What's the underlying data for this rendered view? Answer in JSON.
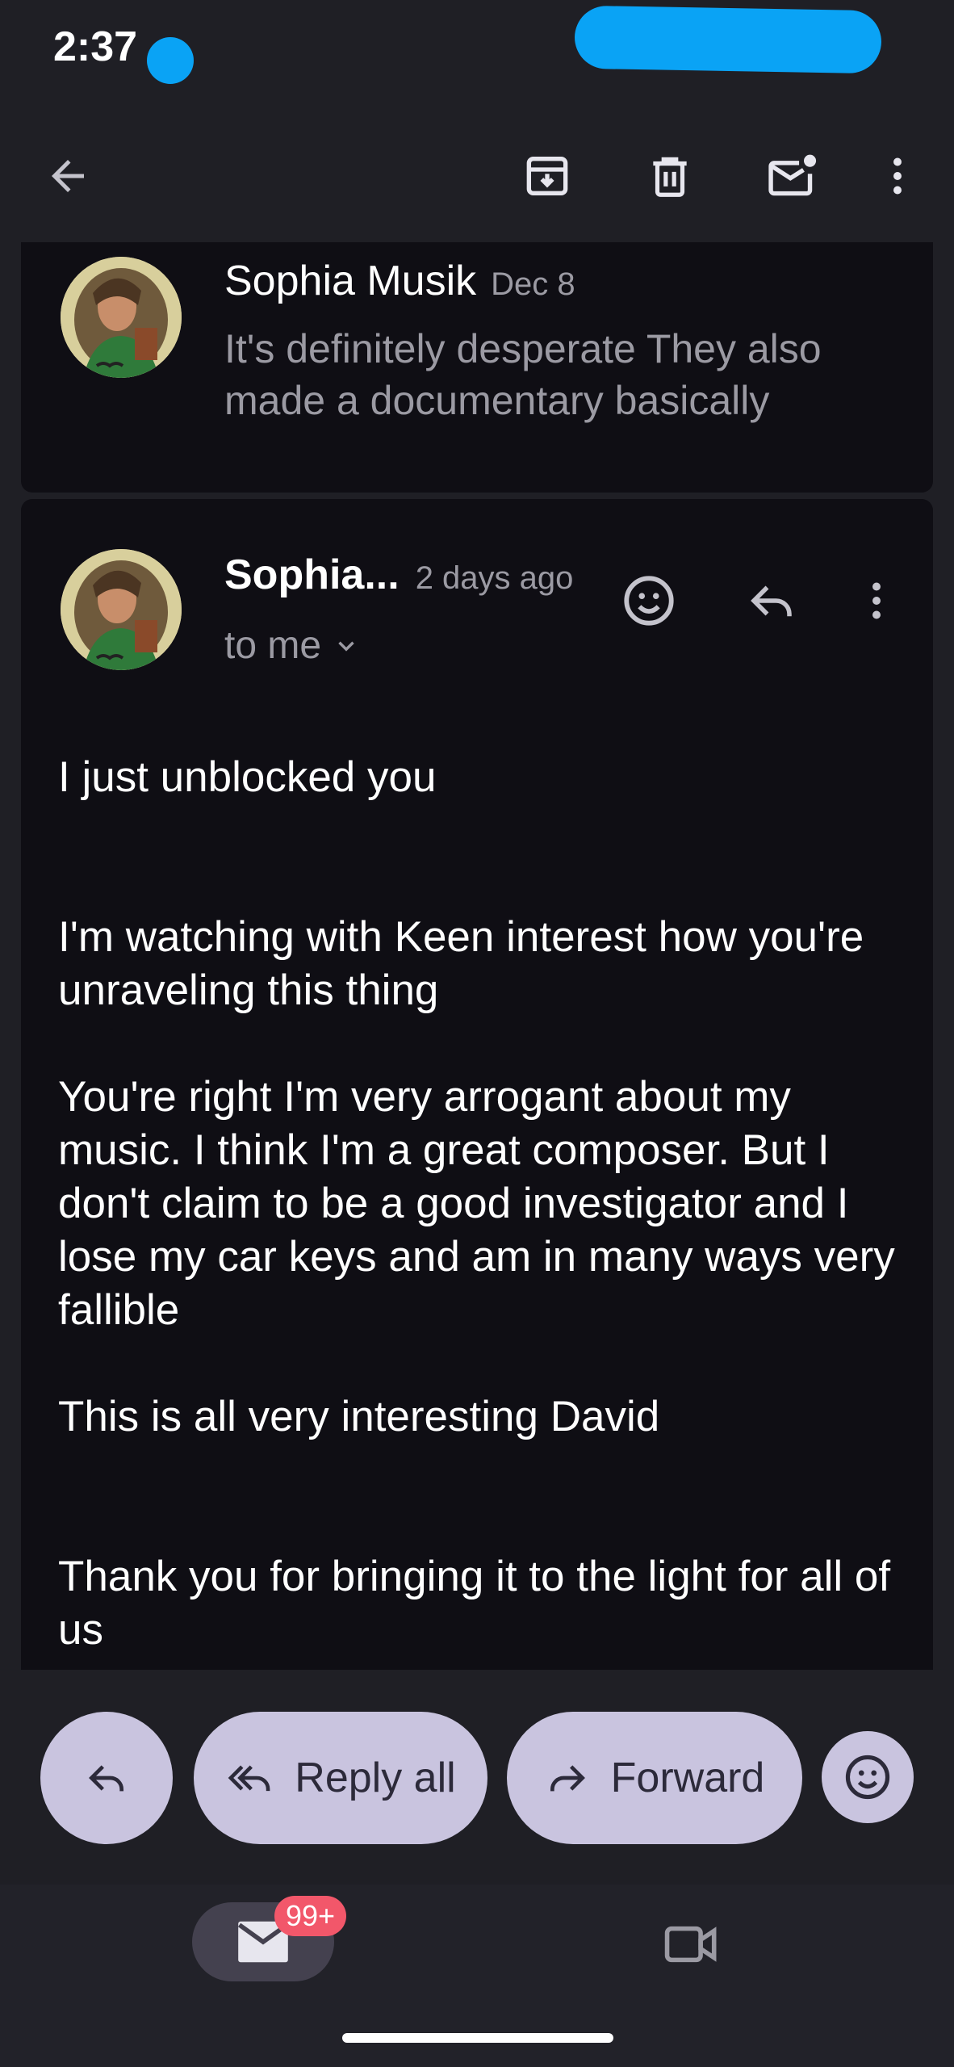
{
  "status_bar": {
    "time": "2:37"
  },
  "toolbar": {
    "back": "arrow-back-icon",
    "archive": "archive-icon",
    "delete": "trash-icon",
    "mark_unread": "mark-unread-icon",
    "more": "more-vert-icon"
  },
  "thread": {
    "collapsed_message": {
      "sender": "Sophia Musik",
      "date": "Dec 8",
      "snippet": "It's definitely desperate They also made a documentary basically"
    },
    "expanded_message": {
      "sender": "Sophia...",
      "date": "2 days ago",
      "recipient": "to me",
      "body": "I just unblocked you\n\n\n I'm watching with Keen interest how you're unraveling this thing\n\nYou're right I'm very arrogant about my music. I think I'm a great composer. But I don't claim to be a good investigator and I lose my car keys and am in many ways very fallible\n\nThis is all very interesting David\n\n\nThank you for bringing it to the light for all of us"
    }
  },
  "actions": {
    "reply_all": "Reply all",
    "forward": "Forward"
  },
  "bottom_nav": {
    "mail_badge": "99+"
  },
  "colors": {
    "background": "#1f1f25",
    "card": "#0f0e14",
    "pill": "#c9c4df",
    "badge": "#f2576a",
    "redaction": "#0aa3f5"
  }
}
